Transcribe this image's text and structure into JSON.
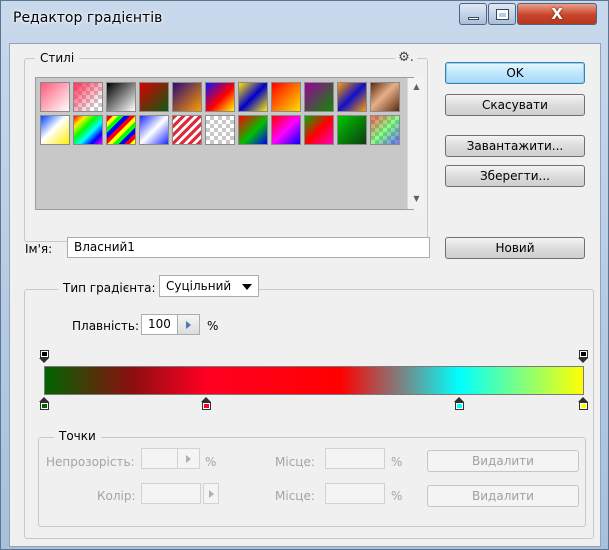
{
  "window": {
    "title": "Редактор градієнтів",
    "close_glyph": "X"
  },
  "presets": {
    "legend": "Стилі",
    "menu_icon": "gear-icon",
    "gradients": [
      "linear-gradient(135deg,#ff5a79 0%,#fff 100%)",
      "checker-red",
      "linear-gradient(135deg,#000 0%,#fff 100%)",
      "linear-gradient(135deg,#d90000 0%,#0b5c12 100%)",
      "linear-gradient(135deg,#2a0a7a 0%,#ff9a00 100%)",
      "linear-gradient(135deg,#1010ff 0%,#ff0000 55%,#ffff00 100%)",
      "linear-gradient(135deg,#ffe800 0%,#0000cc 50%,#ffee00 100%)",
      "linear-gradient(135deg,#ff0000 0%,#ffe000 100%)",
      "linear-gradient(135deg,#9a00a0 0%,#0f8a00 100%)",
      "linear-gradient(135deg,#ff9a00 0%,#1010c8 50%,#ff9a00 100%)",
      "linear-gradient(135deg,#5a2a10 0%,#e7b089 45%,#5a2a10 100%)",
      "linear-gradient(135deg,#0044ff 0%,#ffffff 45%,#ffee00 100%)",
      "linear-gradient(135deg,#ff0000 0%,#ffee00 20%,#00ff00 40%,#00ffff 60%,#0000ff 80%,#ff00ff 100%)",
      "repeating-linear-gradient(135deg,#ff0000 0 4px,#ffff00 4px 8px,#00ff00 8px 12px,#0000ff 12px 16px)",
      "linear-gradient(135deg,#1a2bff 0%,#ffffff 50%,#1a2bff 100%)",
      "repeating-linear-gradient(135deg,#e02a3a 0 3px,#ffffff 3px 6px)",
      "checker",
      "linear-gradient(135deg,#ff0000 0%,#00c000 55%,#0000ff 100%)",
      "linear-gradient(135deg,#ff0000 0%,#ff00ff 50%,#0000ff 100%)",
      "linear-gradient(135deg,#00b000 0%,#ff0000 50%,#ff00c0 100%)",
      "linear-gradient(135deg,#00c800 0%,#0b3d10 100%)",
      "checker-rainbow"
    ]
  },
  "buttons": {
    "ok": "OK",
    "cancel": "Скасувати",
    "load": "Завантажити...",
    "save": "Зберегти...",
    "new": "Новий"
  },
  "name": {
    "label": "Ім'я:",
    "value": "Власний1"
  },
  "gradient": {
    "type_label": "Тип градієнта:",
    "type_value": "Суцільний",
    "smoothness_label": "Плавність:",
    "smoothness_value": "100",
    "smoothness_unit": "%",
    "bar_colors": [
      "#006400",
      "#8b0f10",
      "#ff0022",
      "#ff0000",
      "#00ffff",
      "#ffff00"
    ],
    "opacity_stop_color": "#000000",
    "color_stops": [
      {
        "location": 0,
        "color": "#006400"
      },
      {
        "location": 30,
        "color": "#ff0022"
      },
      {
        "location": 77,
        "color": "#00ffff"
      },
      {
        "location": 100,
        "color": "#ffff00"
      }
    ],
    "opacity_stops": [
      {
        "location": 0
      },
      {
        "location": 100
      }
    ]
  },
  "stops_panel": {
    "legend": "Точки",
    "opacity_label": "Непрозорість:",
    "opacity_unit": "%",
    "location_label": "Місце:",
    "location_unit": "%",
    "color_label": "Колір:",
    "delete_label": "Видалити"
  }
}
